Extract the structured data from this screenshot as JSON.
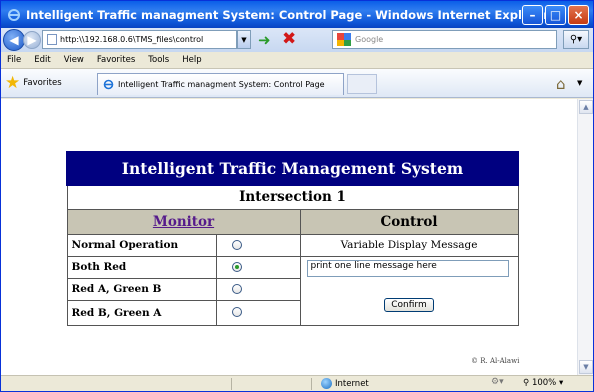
{
  "window": {
    "title": "Intelligent Traffic managment System: Control Page - Windows Internet Explorer",
    "minimize": "–",
    "maximize": "□",
    "close": "×"
  },
  "address_bar": {
    "url": "http:\\\\192.168.0.6\\TMS_files\\control",
    "search_placeholder": "Google"
  },
  "menu": [
    "File",
    "Edit",
    "View",
    "Favorites",
    "Tools",
    "Help"
  ],
  "favorites_bar": {
    "favorites_label": "Favorites",
    "tab_title": "Intelligent Traffic managment System: Control Page"
  },
  "page": {
    "heading": "Intelligent Traffic Management System",
    "intersection": "Intersection 1",
    "monitor_link": "Monitor",
    "control_heading": "Control",
    "rows": [
      {
        "label": "Normal Operation",
        "checked": false
      },
      {
        "label": "Both Red",
        "checked": true
      },
      {
        "label": "Red A, Green B",
        "checked": false
      },
      {
        "label": "Red B, Green A",
        "checked": false
      }
    ],
    "vdm_label": "Variable Display Message",
    "message_value": "print one line message here",
    "confirm_label": "Confirm",
    "copyright": "© R. Al-Alawi"
  },
  "status_bar": {
    "zone": "Internet",
    "zoom": "100%"
  }
}
